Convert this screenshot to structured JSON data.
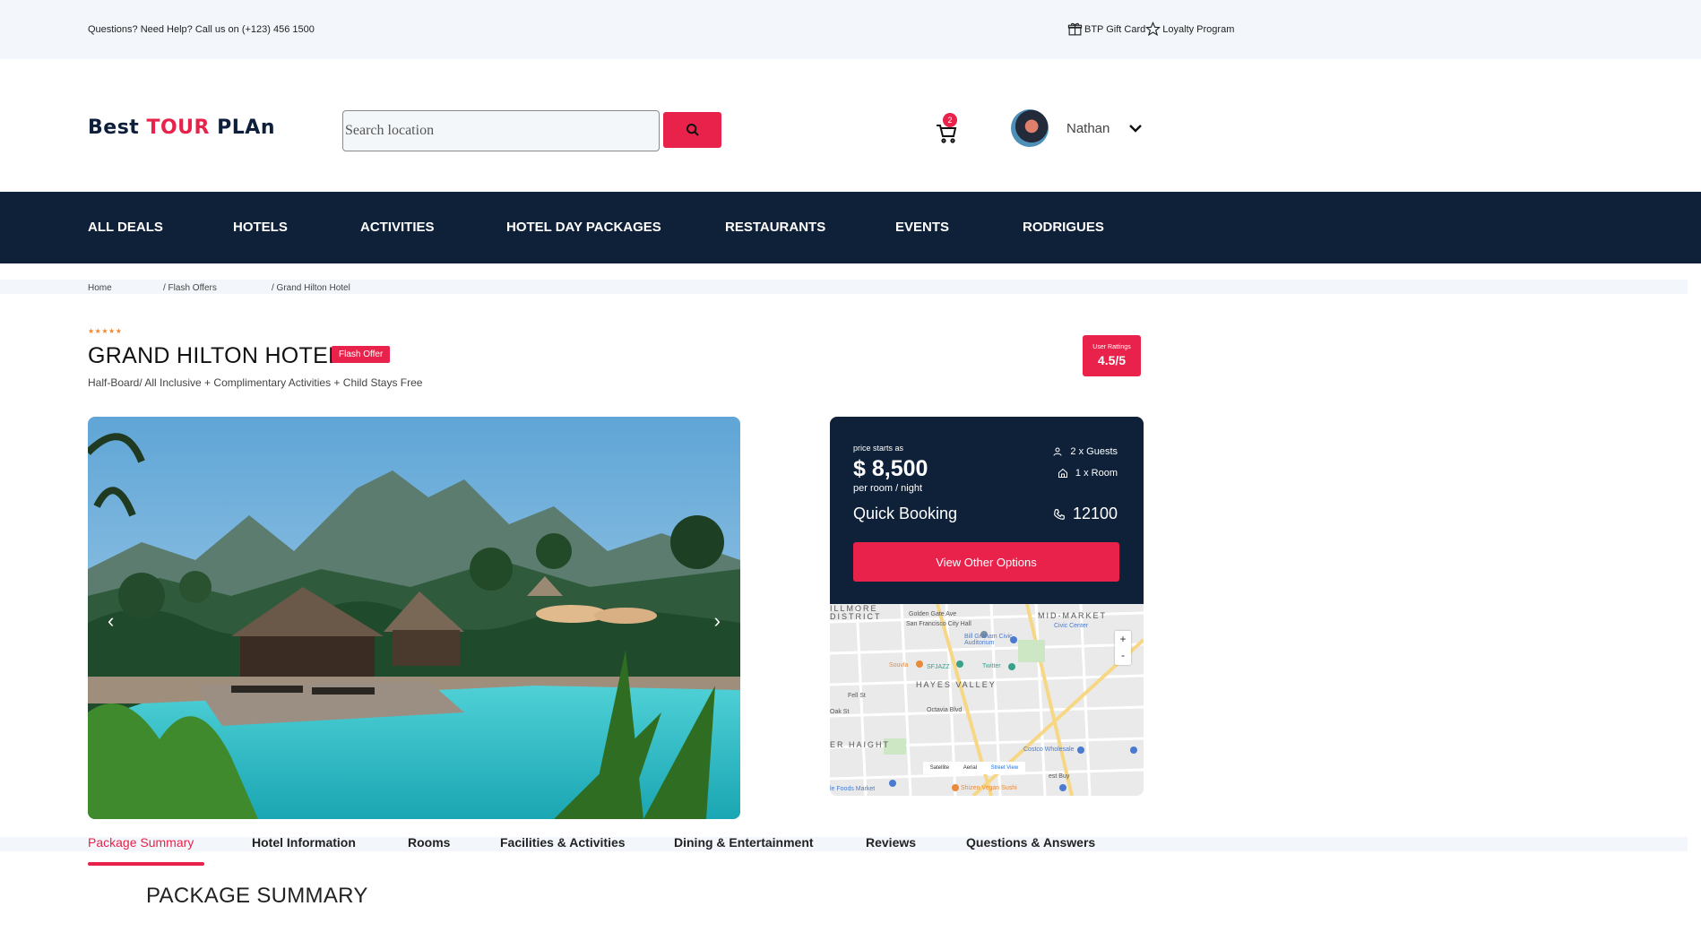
{
  "topbar": {
    "help_text": "Questions? Need Help? Call us on (+123) 456 1500",
    "gift_card": "BTP Gift Card",
    "loyalty": "Loyalty Program"
  },
  "header": {
    "logo_best": "Best ",
    "logo_tour": "TOUR",
    "logo_plan": " PLAn",
    "search_placeholder": "Search location",
    "cart_count": "2",
    "user_name": "Nathan"
  },
  "nav": [
    "ALL DEALS",
    "HOTELS",
    "ACTIVITIES",
    "HOTEL DAY PACKAGES",
    "RESTAURANTS",
    "EVENTS",
    "RODRIGUES"
  ],
  "breadcrumb": [
    "Home",
    "/ Flash Offers",
    "/ Grand Hilton Hotel"
  ],
  "hotel": {
    "stars": "★★★★★",
    "name": "GRAND HILTON HOTEL",
    "badge": "Flash Offer",
    "subtitle": "Half-Board/ All Inclusive + Complimentary Activities + Child Stays Free",
    "rating_label": "User Rattings",
    "rating_value": "4.5/5"
  },
  "booking": {
    "price_label": "price starts as",
    "price": "$ 8,500",
    "per": "per room / night",
    "guests": "2 x Guests",
    "rooms": "1 x Room",
    "quick": "Quick Booking",
    "phone": "12100",
    "button": "View Other Options"
  },
  "map": {
    "areas": [
      "ILLMORE",
      "DISTRICT",
      "MID-MARKET",
      "HAYES VALLEY",
      "ER HAIGHT"
    ],
    "places": [
      "Golden Gate Ave",
      "San Francisco City Hall",
      "Civic Center",
      "Bill Graham Civic Auditorium",
      "Souvla",
      "SFJAZZ",
      "Twitter",
      "Costco Wholesale",
      "est Buy",
      "le Foods Market",
      "Shizen Vegan Sushi",
      "Fell St",
      "Oak St",
      "Octavia Blvd"
    ],
    "zoom_in": "+",
    "zoom_out": "-",
    "types": [
      "Satellite",
      "Aerial",
      "Street View"
    ]
  },
  "tabs": [
    "Package Summary",
    "Hotel Information",
    "Rooms",
    "Facilities & Activities",
    "Dining & Entertainment",
    "Reviews",
    "Questions & Answers"
  ],
  "section_title": "PACKAGE SUMMARY",
  "colors": {
    "accent": "#e8224a",
    "navy": "#0f2138",
    "light": "#f3f7fb"
  }
}
